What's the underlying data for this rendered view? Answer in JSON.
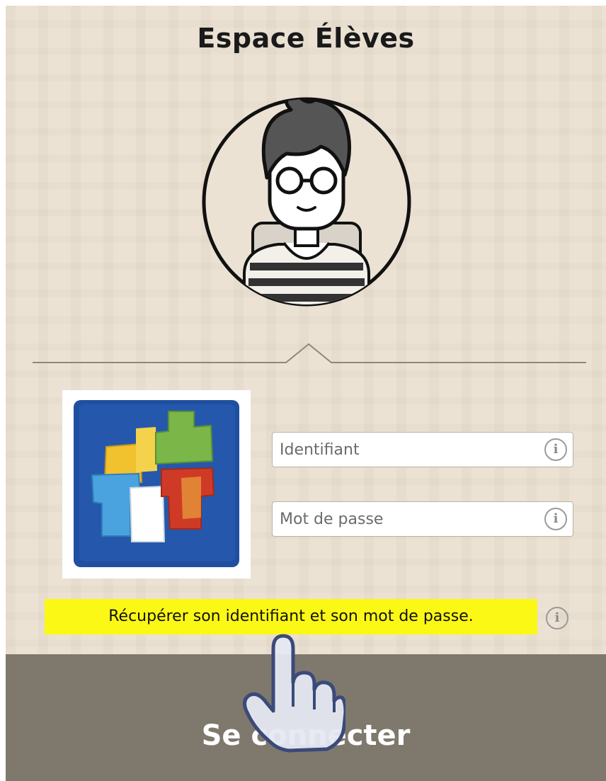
{
  "page": {
    "title": "Espace Élèves"
  },
  "avatar": {
    "icon": "student-avatar-icon"
  },
  "logo": {
    "icon": "school-logo-icon",
    "colors": [
      "#1f4fa0",
      "#f2c12e",
      "#7ab648",
      "#cf3a26",
      "#4aa3df",
      "#ffffff"
    ]
  },
  "form": {
    "identifiant": {
      "placeholder": "Identifiant",
      "value": ""
    },
    "password": {
      "placeholder": "Mot de passe",
      "value": ""
    },
    "info_glyph": "i"
  },
  "recover": {
    "label": "Récupérer son identifiant et son mot de passe."
  },
  "connect": {
    "label": "Se connecter"
  },
  "colors": {
    "background": "#ebe2d4",
    "highlight": "#fcf815",
    "button": "#7f786d"
  }
}
